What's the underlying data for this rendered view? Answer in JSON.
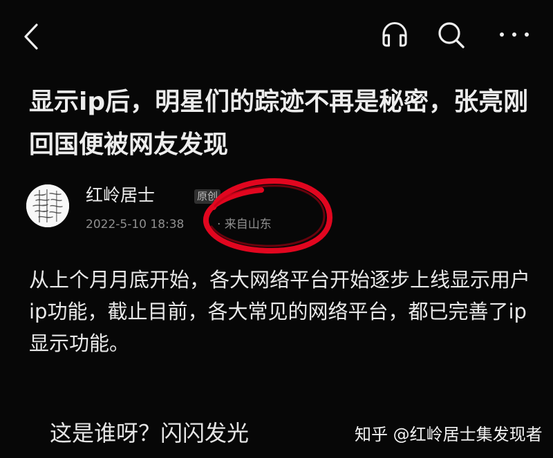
{
  "topbar": {
    "back_icon": "chevron-left-icon",
    "audio_icon": "headphones-icon",
    "search_icon": "search-icon",
    "more_icon": "more-horizontal-icon"
  },
  "article": {
    "title": "显示ip后，明星们的踪迹不再是秘密，张亮刚回国便被网友发现",
    "author": {
      "name": "红岭居士",
      "badge": "原创",
      "date": "2022-5-10 18:38",
      "location": "· 来自山东"
    },
    "body": "从上个月月底开始，各大网络平台开始逐步上线显示用户ip功能，截止目前，各大常见的网络平台，都已完善了ip显示功能。",
    "bottom_question": "这是谁呀？闪闪发光"
  },
  "watermark": "知乎 @红岭居士集发现者",
  "colors": {
    "background": "#070707",
    "text": "#e8e8e8",
    "muted_text": "#8f8f8f",
    "annotation": "#e1061f"
  }
}
